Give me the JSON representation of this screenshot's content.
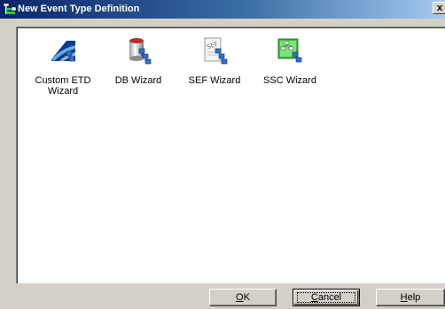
{
  "window": {
    "title": "New Event Type Definition",
    "close_label": "x"
  },
  "wizards": [
    {
      "label": "Custom ETD Wizard",
      "icon": "custom-etd-icon"
    },
    {
      "label": "DB Wizard",
      "icon": "db-wizard-icon"
    },
    {
      "label": "SEF Wizard",
      "icon": "sef-wizard-icon"
    },
    {
      "label": "SSC Wizard",
      "icon": "ssc-wizard-icon"
    }
  ],
  "buttons": {
    "ok": {
      "mnemonic": "O",
      "rest": "K"
    },
    "cancel": {
      "mnemonic": "C",
      "rest": "ancel"
    },
    "help": {
      "mnemonic": "H",
      "rest": "elp"
    }
  },
  "colors": {
    "titlebar_start": "#0a246a",
    "titlebar_end": "#a6caf0",
    "window_bg": "#d4d0c8",
    "list_bg": "#ffffff"
  }
}
